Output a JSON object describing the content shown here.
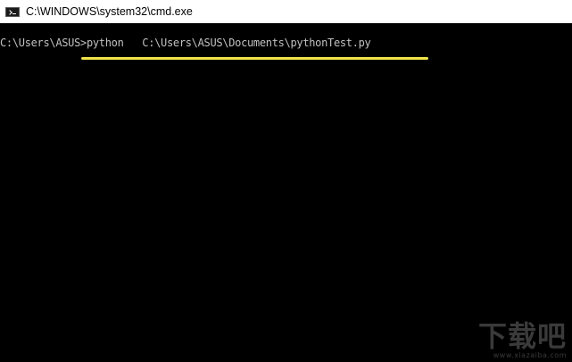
{
  "window": {
    "title": "C:\\WINDOWS\\system32\\cmd.exe",
    "icon": "cmd-icon"
  },
  "console": {
    "prompt": "C:\\Users\\ASUS>",
    "command": "python   C:\\Users\\ASUS\\Documents\\pythonTest.py",
    "text_color": "#c0c0c0",
    "background": "#000000",
    "highlight_color": "#f0e44a"
  },
  "watermark": {
    "title": "下载吧",
    "url": "www.xiazaiba.com"
  }
}
